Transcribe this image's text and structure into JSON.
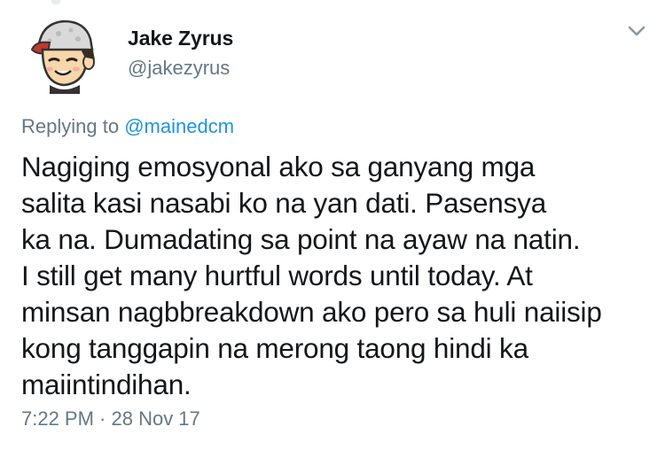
{
  "author": {
    "display_name": "Jake Zyrus",
    "handle": "@jakezyrus",
    "avatar_icon": "cartoon-avatar-icon"
  },
  "header": {
    "menu_icon": "chevron-down-icon"
  },
  "reply": {
    "prefix": "Replying to",
    "mention": "@mainedcm"
  },
  "tweet": {
    "text": "Nagiging emosyonal ako sa ganyang mga\nsalita kasi nasabi ko na yan dati. Pasensya\nka na. Dumadating sa point na ayaw na natin.\nI still get many hurtful words until today. At\nminsan nagbbreakdown ako pero sa huli naiisip\nkong tanggapin na merong taong hindi ka\nmaiintindihan."
  },
  "meta": {
    "timestamp": "7:22 PM · 28 Nov 17"
  },
  "colors": {
    "text": "#14171a",
    "secondary": "#657786",
    "link": "#1b95e0",
    "background": "#ffffff"
  }
}
